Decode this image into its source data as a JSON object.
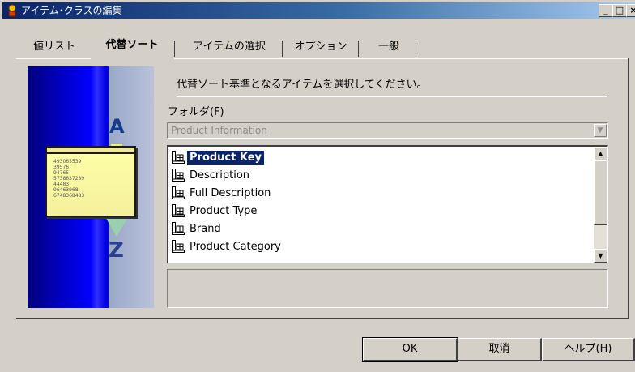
{
  "window": {
    "title": "アイテム･クラスの編集"
  },
  "tabs": [
    {
      "label": "値リスト"
    },
    {
      "label": "代替ソート",
      "active": true
    },
    {
      "label": "アイテムの選択"
    },
    {
      "label": "オプション"
    },
    {
      "label": "一般"
    }
  ],
  "graphic": {
    "letter_top": "A",
    "letter_bottom": "Z",
    "card_lines": [
      "493065539",
      "39576",
      "94765",
      "5738637289",
      "44483",
      "96463968",
      "6748368483"
    ]
  },
  "instruction": "代替ソート基準となるアイテムを選択してください。",
  "folder": {
    "label": "フォルダ(F)",
    "value": "Product Information"
  },
  "items": [
    {
      "label": "Product Key",
      "selected": true
    },
    {
      "label": "Description"
    },
    {
      "label": "Full Description"
    },
    {
      "label": "Product Type"
    },
    {
      "label": "Brand"
    },
    {
      "label": "Product Category"
    }
  ],
  "buttons": {
    "ok": "OK",
    "cancel": "取消",
    "help": "ヘルプ(H)"
  }
}
